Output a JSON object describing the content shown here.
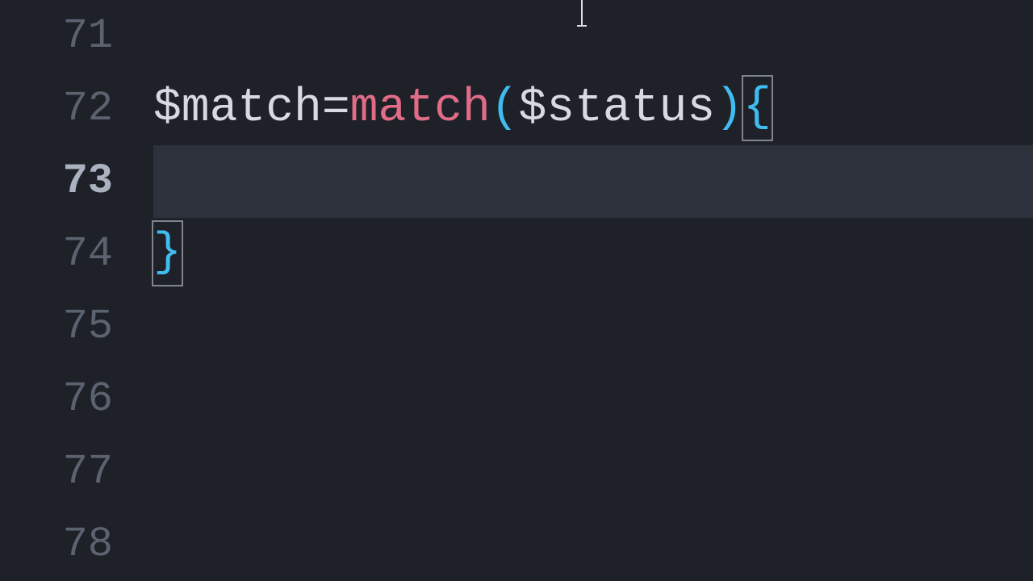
{
  "editor": {
    "lines": {
      "71": "71",
      "72": "72",
      "73": "73",
      "74": "74",
      "75": "75",
      "76": "76",
      "77": "77",
      "78": "78"
    },
    "code": {
      "line72": {
        "var1": "$match",
        "op": "=",
        "func": "match",
        "lparen": "(",
        "arg": "$status",
        "rparen": ")",
        "lbrace": "{"
      },
      "line74": {
        "rbrace": "}"
      }
    },
    "current_line": "73"
  }
}
